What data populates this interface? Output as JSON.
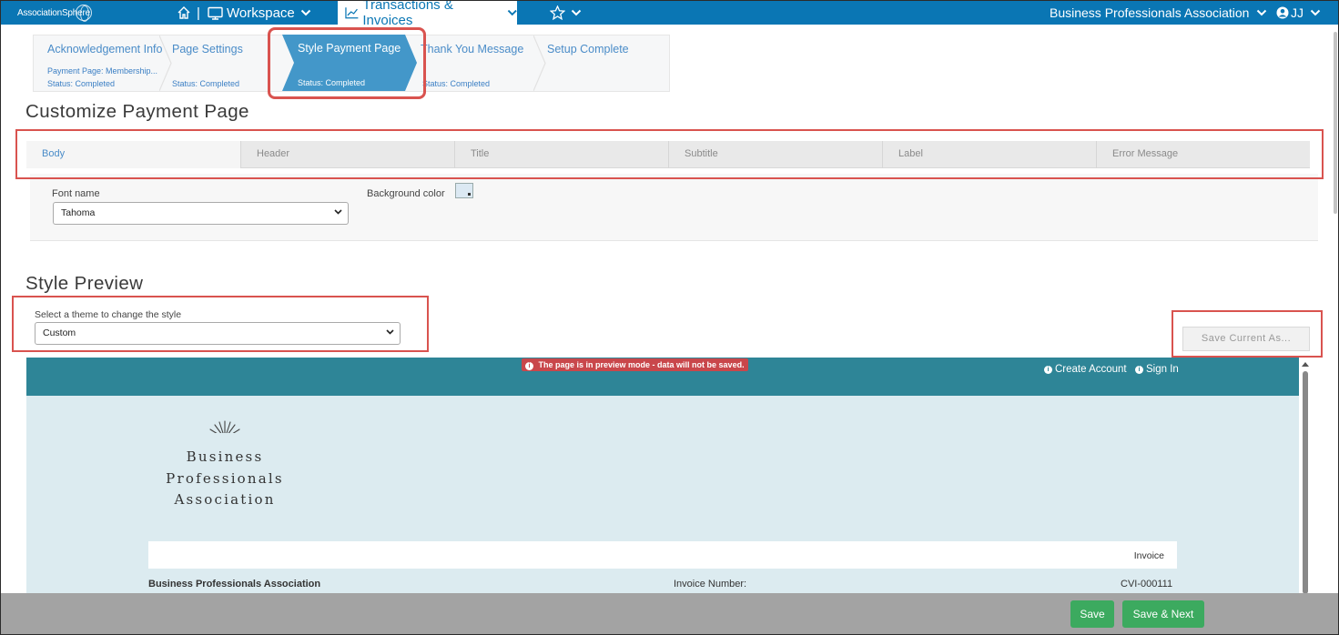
{
  "topbar": {
    "logo_text": "AssociationSphere",
    "workspace": "Workspace",
    "separator": "|",
    "transactions": "Transactions & Invoices",
    "organization": "Business Professionals Association",
    "user_initials": "JJ",
    "bar_color": "#0a76b4"
  },
  "wizard": {
    "steps": [
      {
        "title": "Acknowledgement Info",
        "subtitle": "Payment Page: Membership...",
        "status": "Status: Completed"
      },
      {
        "title": "Page Settings",
        "status": "Status: Completed"
      },
      {
        "title": "Style Payment Page",
        "status": "Status: Completed",
        "active": true
      },
      {
        "title": "Thank You Message",
        "status": "Status: Completed"
      },
      {
        "title": "Setup Complete"
      }
    ],
    "active_color": "#4397c9"
  },
  "customize": {
    "heading": "Customize Payment Page",
    "tabs": [
      "Body",
      "Header",
      "Title",
      "Subtitle",
      "Label",
      "Error Message"
    ],
    "active_tab": "Body",
    "font_name_label": "Font name",
    "font_name_value": "Tahoma",
    "background_color_label": "Background color"
  },
  "style_preview": {
    "heading": "Style Preview",
    "theme_label": "Select a theme to change the style",
    "theme_value": "Custom",
    "save_current_button": "Save Current As..."
  },
  "preview": {
    "notice": "The page is in preview mode - data will not be saved.",
    "create_account": "Create Account",
    "sign_in": "Sign In",
    "org_logo_lines": [
      "Business",
      "Professionals",
      "Association"
    ],
    "invoice_label": "Invoice",
    "org_name": "Business Professionals Association",
    "invoice_number_label": "Invoice Number:",
    "invoice_number_value": "CVI-000111",
    "header_color": "#2e8597",
    "body_color": "#dcebf0"
  },
  "footer": {
    "save_label": "Save",
    "save_next_label": "Save & Next",
    "button_color": "#3caa5f"
  },
  "highlight_color": "#d9534f"
}
